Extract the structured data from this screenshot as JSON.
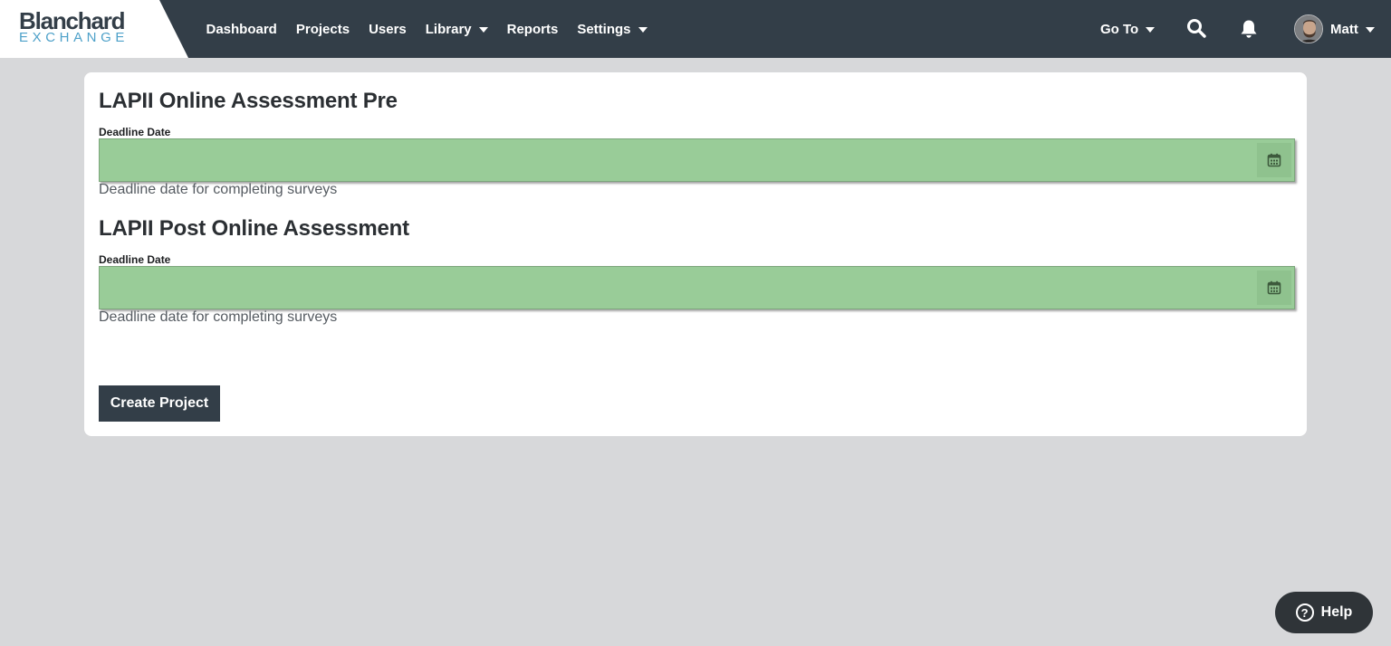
{
  "brand": {
    "name_main": "Blanchard",
    "name_sub": "EXCHANGE",
    "accent_color": "#4ea1c9",
    "nav_bg_color": "#333e48"
  },
  "nav": {
    "items": [
      {
        "label": "Dashboard",
        "dropdown": false
      },
      {
        "label": "Projects",
        "dropdown": false
      },
      {
        "label": "Users",
        "dropdown": false
      },
      {
        "label": "Library",
        "dropdown": true
      },
      {
        "label": "Reports",
        "dropdown": false
      },
      {
        "label": "Settings",
        "dropdown": true
      }
    ],
    "goto_label": "Go To",
    "search_icon": "search-icon",
    "notification_icon": "bell-icon",
    "user_name": "Matt"
  },
  "form": {
    "sections": [
      {
        "title": "LAPII Online Assessment Pre",
        "field_label": "Deadline Date",
        "value": "",
        "help": "Deadline date for completing surveys",
        "field_color": "#99cc98"
      },
      {
        "title": "LAPII Post Online Assessment",
        "field_label": "Deadline Date",
        "value": "",
        "help": "Deadline date for completing surveys",
        "field_color": "#99cc98"
      }
    ],
    "submit_label": "Create Project"
  },
  "help_widget": {
    "label": "Help",
    "icon_glyph": "?"
  }
}
